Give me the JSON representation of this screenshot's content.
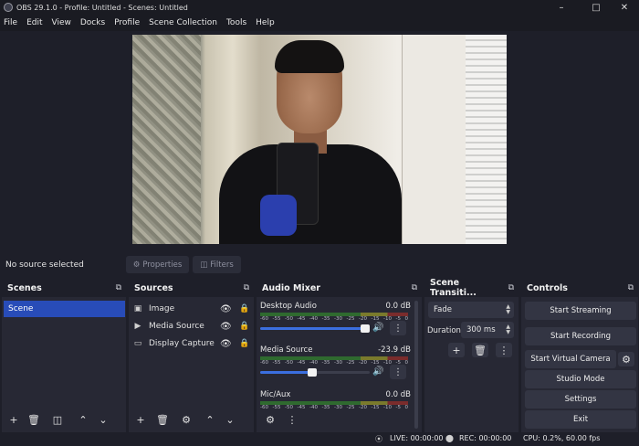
{
  "window": {
    "title": "OBS 29.1.0 - Profile: Untitled - Scenes: Untitled",
    "minimize_icon": "minimize-icon",
    "maximize_icon": "maximize-icon",
    "close_icon": "close-icon"
  },
  "menu": [
    "File",
    "Edit",
    "View",
    "Docks",
    "Profile",
    "Scene Collection",
    "Tools",
    "Help"
  ],
  "info_bar": {
    "no_source": "No source selected",
    "properties": "Properties",
    "filters": "Filters"
  },
  "scenes": {
    "title": "Scenes",
    "items": [
      "Scene"
    ]
  },
  "sources": {
    "title": "Sources",
    "items": [
      {
        "label": "Image",
        "icon": "image-icon"
      },
      {
        "label": "Media Source",
        "icon": "play-icon"
      },
      {
        "label": "Display Capture",
        "icon": "monitor-icon"
      }
    ]
  },
  "audio_mixer": {
    "title": "Audio Mixer",
    "scale": [
      "-60",
      "-55",
      "-50",
      "-45",
      "-40",
      "-35",
      "-30",
      "-25",
      "-20",
      "-15",
      "-10",
      "-5",
      "0"
    ],
    "channels": [
      {
        "name": "Desktop Audio",
        "db": "0.0 dB",
        "volume": 1.0
      },
      {
        "name": "Media Source",
        "db": "-23.9 dB",
        "volume": 0.47
      },
      {
        "name": "Mic/Aux",
        "db": "0.0 dB",
        "volume": 1.0
      }
    ]
  },
  "transitions": {
    "title": "Scene Transiti...",
    "selected": "Fade",
    "duration_label": "Duration",
    "duration_value": "300 ms"
  },
  "controls": {
    "title": "Controls",
    "start_streaming": "Start Streaming",
    "start_recording": "Start Recording",
    "start_virtual_camera": "Start Virtual Camera",
    "studio_mode": "Studio Mode",
    "settings": "Settings",
    "exit": "Exit"
  },
  "status": {
    "live": "LIVE: 00:00:00",
    "rec": "REC: 00:00:00",
    "cpu": "CPU: 0.2%, 60.00 fps"
  },
  "colors": {
    "accent": "#284cb8",
    "panel": "#272834",
    "background": "#1e1f29"
  }
}
